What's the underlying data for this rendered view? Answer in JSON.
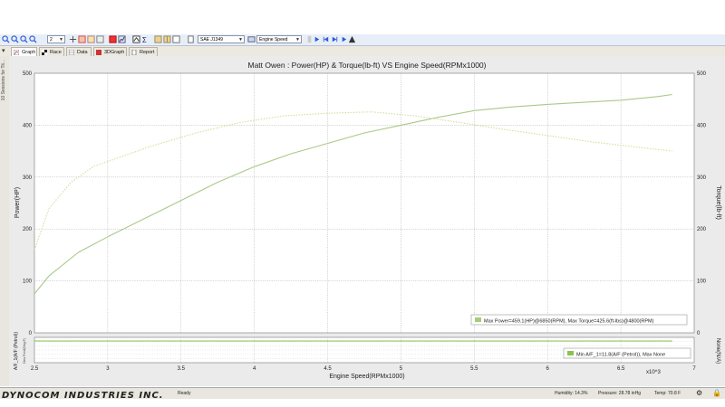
{
  "toolbar": {
    "zoom_value": "2",
    "standard_value": "SAE J1349",
    "axis_value": "Engine Speed"
  },
  "tabs": [
    {
      "label": "Graph",
      "active": true
    },
    {
      "label": "Race",
      "active": false
    },
    {
      "label": "Data",
      "active": false
    },
    {
      "label": "3DGraph",
      "active": false
    },
    {
      "label": "Report",
      "active": false
    }
  ],
  "sidebar": {
    "label": "10 Sessions for Tit..."
  },
  "chart_data": {
    "type": "line",
    "title": "Matt Owen : Power(HP) & Torque(lb-ft) VS Engine Speed(RPMx1000)",
    "xlabel": "Engine Speed(RPMx1000)",
    "x_multiplier": "x10^3",
    "ylabel_left": "Power(HP)",
    "ylabel_right": "Torque(lb-ft)",
    "xlim": [
      2.5,
      7
    ],
    "ylim": [
      0,
      500
    ],
    "x_ticks": [
      "2.5",
      "3",
      "3.5",
      "4",
      "4.5",
      "5",
      "5.5",
      "6",
      "6.5",
      "7"
    ],
    "y_ticks": [
      "0",
      "100",
      "200",
      "300",
      "400",
      "500"
    ],
    "grid": true,
    "series": [
      {
        "axis": "left",
        "color": "#a9c98a",
        "style": "solid",
        "x": [
          2.5,
          2.6,
          2.8,
          3.0,
          3.25,
          3.5,
          3.75,
          4.0,
          4.25,
          4.5,
          4.75,
          5.0,
          5.25,
          5.5,
          5.75,
          6.0,
          6.25,
          6.5,
          6.75,
          6.85
        ],
        "y": [
          75,
          110,
          155,
          185,
          220,
          255,
          290,
          320,
          345,
          365,
          385,
          400,
          415,
          428,
          435,
          440,
          444,
          448,
          455,
          459.1
        ]
      },
      {
        "axis": "right",
        "color": "#d6dc9c",
        "style": "dotted",
        "x": [
          2.5,
          2.6,
          2.75,
          2.9,
          3.1,
          3.3,
          3.6,
          3.9,
          4.2,
          4.5,
          4.8,
          5.1,
          5.4,
          5.7,
          6.0,
          6.3,
          6.6,
          6.85
        ],
        "y": [
          160,
          240,
          290,
          320,
          340,
          360,
          385,
          405,
          418,
          423,
          425.6,
          418,
          405,
          392,
          380,
          368,
          358,
          350
        ]
      }
    ],
    "legend": "Max Power=459.1(HP)@6850(RPM), Max Torque=425.6(ft-lbs)@4800(RPM)",
    "legend_placement": "bottom-right",
    "subplot": {
      "ylabel": "A/F_1(A/F (Petrol))",
      "ylabel_small": "Dew Point(Deg.F)",
      "legend": "Min A/F_1=11.8(A/F (Petrol)), Max None",
      "ylabel_right": "None(N/A)",
      "color": "#8bc34a"
    }
  },
  "status": {
    "logo": "DYNOCOM INDUSTRIES INC.",
    "ready": "Ready",
    "humidity": "Humidity: 14.3%",
    "pressure": "Pressure: 28.78 inHg",
    "temp": "Temp: 70.8 F"
  }
}
